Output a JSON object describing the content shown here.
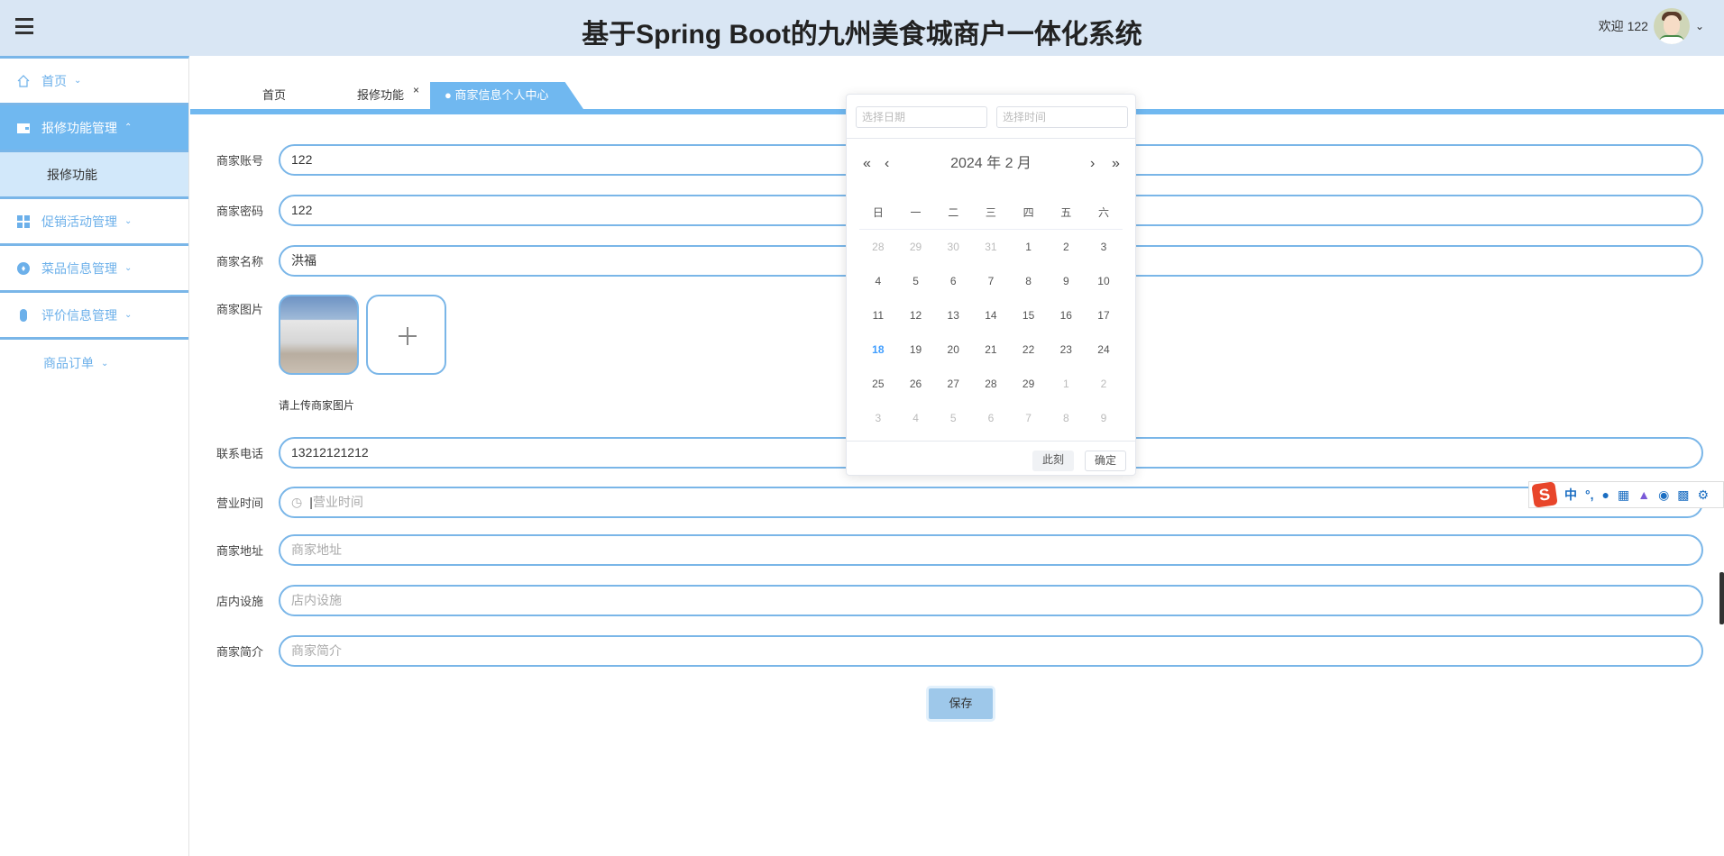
{
  "header": {
    "title": "基于Spring Boot的九州美食城商户一体化系统",
    "welcome": "欢迎 122",
    "menu_icon": "menu-fold-icon",
    "avatar_icon": "user-avatar",
    "chevron": "⌄"
  },
  "sidebar": {
    "items": [
      {
        "label": "首页",
        "icon": "home-icon",
        "arrow": "⌄"
      },
      {
        "label": "报修功能管理",
        "icon": "wallet-icon",
        "arrow": "⌃"
      },
      {
        "label": "报修功能"
      },
      {
        "label": "促销活动管理",
        "icon": "grid-icon",
        "arrow": "⌄"
      },
      {
        "label": "菜品信息管理",
        "icon": "circle-icon",
        "arrow": "⌄"
      },
      {
        "label": "评价信息管理",
        "icon": "mouse-icon",
        "arrow": "⌄"
      },
      {
        "label": "商品订单",
        "arrow": "⌄"
      }
    ]
  },
  "tabs": [
    {
      "label": "首页"
    },
    {
      "label": "报修功能",
      "close": "×"
    },
    {
      "label": "● 商家信息个人中心",
      "close": "×"
    }
  ],
  "form": {
    "account": {
      "label": "商家账号",
      "value": "122"
    },
    "password": {
      "label": "商家密码",
      "value": "122"
    },
    "name": {
      "label": "商家名称",
      "value": "洪福"
    },
    "image": {
      "label": "商家图片",
      "hint": "请上传商家图片"
    },
    "phone": {
      "label": "联系电话",
      "value": "13212121212"
    },
    "hours": {
      "label": "营业时间",
      "placeholder": "营业时间"
    },
    "address": {
      "label": "商家地址",
      "placeholder": "商家地址"
    },
    "facilities": {
      "label": "店内设施",
      "placeholder": "店内设施"
    },
    "intro": {
      "label": "商家简介",
      "placeholder": "商家简介"
    },
    "save": "保存"
  },
  "datepicker": {
    "date_placeholder": "选择日期",
    "time_placeholder": "选择时间",
    "title": "2024 年  2 月",
    "prev_year": "«",
    "prev_month": "‹",
    "next_month": "›",
    "next_year": "»",
    "weekdays": [
      "日",
      "一",
      "二",
      "三",
      "四",
      "五",
      "六"
    ],
    "weeks": [
      [
        "28",
        "29",
        "30",
        "31",
        "1",
        "2",
        "3"
      ],
      [
        "4",
        "5",
        "6",
        "7",
        "8",
        "9",
        "10"
      ],
      [
        "11",
        "12",
        "13",
        "14",
        "15",
        "16",
        "17"
      ],
      [
        "18",
        "19",
        "20",
        "21",
        "22",
        "23",
        "24"
      ],
      [
        "25",
        "26",
        "27",
        "28",
        "29",
        "1",
        "2"
      ],
      [
        "3",
        "4",
        "5",
        "6",
        "7",
        "8",
        "9"
      ]
    ],
    "today": "18",
    "now_btn": "此刻",
    "confirm_btn": "确定"
  },
  "ime": {
    "logo": "S",
    "mode": "中",
    "punct": "°,",
    "icons": [
      "mic-icon",
      "keyboard-icon",
      "skin-icon",
      "game-icon",
      "apps-icon",
      "settings-icon"
    ]
  },
  "colors": {
    "accent": "#70b8f0",
    "header_bg": "#d9e6f4",
    "today": "#409eff"
  }
}
